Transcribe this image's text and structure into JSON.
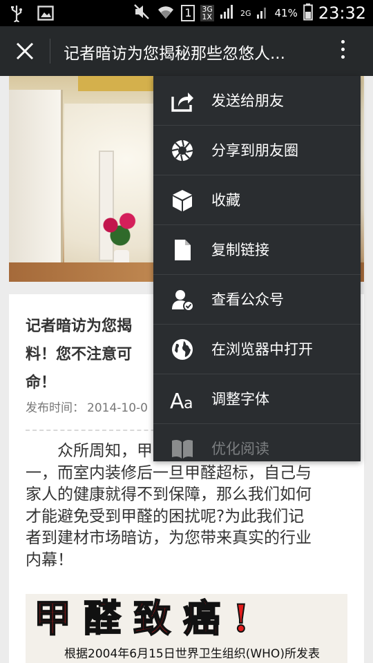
{
  "status_bar": {
    "network_1": "3G",
    "network_2": "1X",
    "network_3": "2G",
    "sim_number": "1",
    "battery_percent": "41%",
    "time": "23:32",
    "icons": [
      "usb-icon",
      "image-icon",
      "mute-icon",
      "wifi-icon",
      "sim-icon",
      "signal-icon",
      "battery-icon"
    ]
  },
  "header": {
    "title": "记者暗访为您揭秘那些忽悠人..."
  },
  "article": {
    "title": "记者暗访为您揭秘那些忽悠人的装修内幕，甲醛超标料！您不注意可能会要命！",
    "title_visible_lines": [
      "记者暗访为您揭",
      "料！您不注意可",
      "命！"
    ],
    "meta_label": "发布时间：",
    "meta_date": "2014-10-0",
    "body_lines": [
      "众所周知，甲",
      "一，而室内装修后一旦甲醛超标，自己与",
      "家人的健康就得不到保障，那么我们如何",
      "才能避免受到甲醛的困扰呢?为此我们记",
      "者到建材市场暗访，为您带来真实的行业",
      "内幕！"
    ],
    "poster_headline": "甲醛致癌!",
    "poster_line_1": "根据2004年6月15日世界卫生组织(WHO)所发表"
  },
  "menu": {
    "items": [
      {
        "label": "发送给朋友",
        "icon": "share-to-friend-icon"
      },
      {
        "label": "分享到朋友圈",
        "icon": "moments-aperture-icon"
      },
      {
        "label": "收藏",
        "icon": "favorite-cube-icon"
      },
      {
        "label": "复制链接",
        "icon": "copy-link-document-icon"
      },
      {
        "label": "查看公众号",
        "icon": "official-account-icon"
      },
      {
        "label": "在浏览器中打开",
        "icon": "globe-icon"
      },
      {
        "label": "调整字体",
        "icon": "font-size-icon"
      },
      {
        "label": "优化阅读",
        "icon": "book-icon"
      }
    ]
  },
  "colors": {
    "status_bar": "#000000",
    "action_bar": "#26292b",
    "menu_bg": "#2a2d30",
    "poster_red": "#e31d1d"
  }
}
